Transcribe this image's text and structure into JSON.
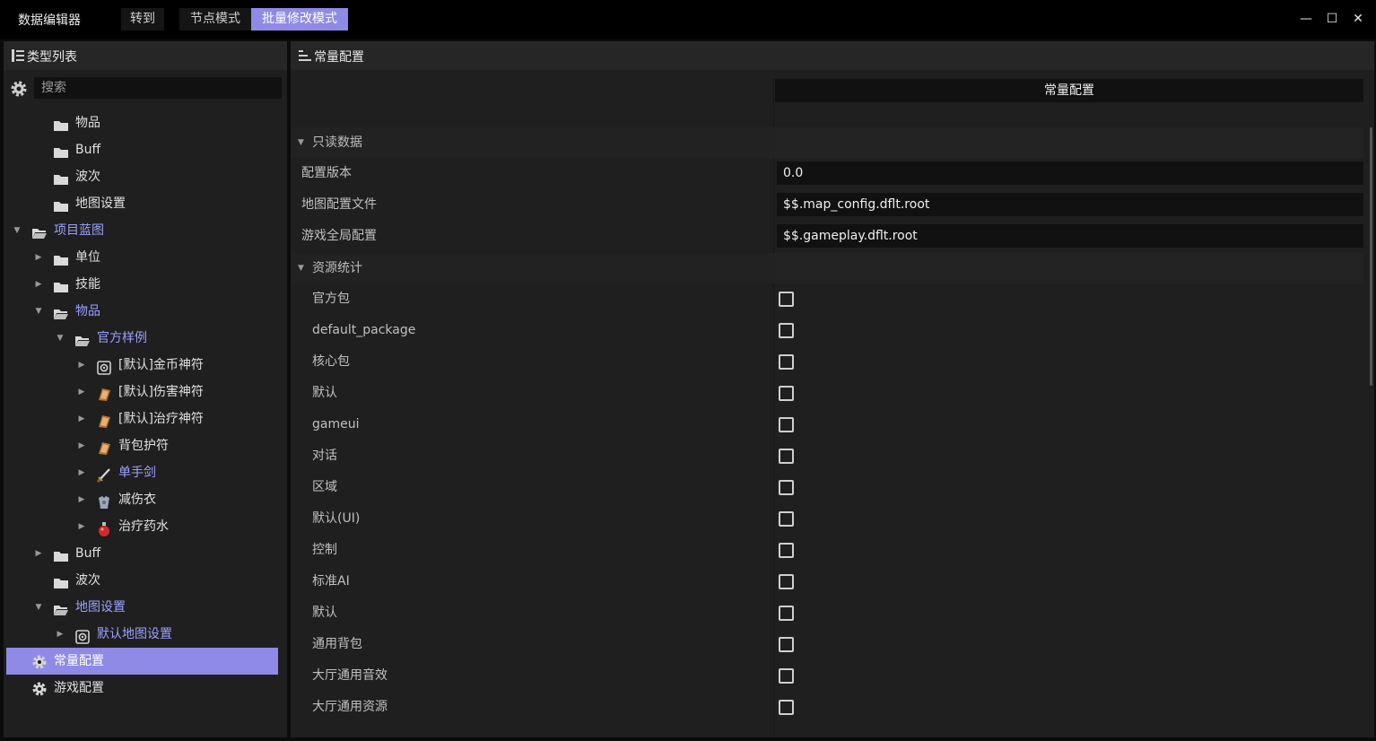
{
  "window": {
    "title": "数据编辑器",
    "menu": [
      {
        "label": "转到",
        "active": false
      },
      {
        "label": "节点模式",
        "active": false
      },
      {
        "label": "批量修改模式",
        "active": true
      }
    ],
    "controls": {
      "minimize": "—",
      "maximize": "☐",
      "close": "✕"
    }
  },
  "left": {
    "header": "类型列表",
    "search_placeholder": "搜索",
    "tree": [
      {
        "label": "物品",
        "depth": 1,
        "arrow": "",
        "icon": "folder-icon"
      },
      {
        "label": "Buff",
        "depth": 1,
        "arrow": "",
        "icon": "folder-icon"
      },
      {
        "label": "波次",
        "depth": 1,
        "arrow": "",
        "icon": "folder-icon"
      },
      {
        "label": "地图设置",
        "depth": 1,
        "arrow": "",
        "icon": "folder-icon"
      },
      {
        "label": "项目蓝图",
        "depth": 0,
        "arrow": "▼",
        "icon": "folder-open-icon",
        "highlight": true
      },
      {
        "label": "单位",
        "depth": 1,
        "arrow": "▶",
        "icon": "folder-icon"
      },
      {
        "label": "技能",
        "depth": 1,
        "arrow": "▶",
        "icon": "folder-icon"
      },
      {
        "label": "物品",
        "depth": 1,
        "arrow": "▼",
        "icon": "folder-open-icon",
        "highlight": true
      },
      {
        "label": "官方样例",
        "depth": 2,
        "arrow": "▼",
        "icon": "folder-open-icon",
        "highlight": true
      },
      {
        "label": "[默认]金币神符",
        "depth": 3,
        "arrow": "▶",
        "icon": "settings-item-icon"
      },
      {
        "label": "[默认]伤害神符",
        "depth": 3,
        "arrow": "▶",
        "icon": "scroll-icon"
      },
      {
        "label": "[默认]治疗神符",
        "depth": 3,
        "arrow": "▶",
        "icon": "scroll-icon"
      },
      {
        "label": "背包护符",
        "depth": 3,
        "arrow": "▶",
        "icon": "scroll-icon"
      },
      {
        "label": "单手剑",
        "depth": 3,
        "arrow": "▶",
        "icon": "sword-icon",
        "highlight": true
      },
      {
        "label": "减伤衣",
        "depth": 3,
        "arrow": "▶",
        "icon": "armor-icon"
      },
      {
        "label": "治疗药水",
        "depth": 3,
        "arrow": "▶",
        "icon": "potion-icon"
      },
      {
        "label": "Buff",
        "depth": 1,
        "arrow": "▶",
        "icon": "folder-icon"
      },
      {
        "label": "波次",
        "depth": 1,
        "arrow": "",
        "icon": "folder-icon"
      },
      {
        "label": "地图设置",
        "depth": 1,
        "arrow": "▼",
        "icon": "folder-open-icon",
        "highlight": true
      },
      {
        "label": "默认地图设置",
        "depth": 2,
        "arrow": "▶",
        "icon": "settings-item-icon",
        "highlight": true
      },
      {
        "label": "常量配置",
        "depth": 0,
        "arrow": "",
        "icon": "gear-icon",
        "selected": true
      },
      {
        "label": "游戏配置",
        "depth": 0,
        "arrow": "",
        "icon": "gear-icon"
      }
    ]
  },
  "right": {
    "header": "常量配置",
    "column_header": "常量配置",
    "group_readonly": "只读数据",
    "fields": [
      {
        "label": "配置版本",
        "value": "0.0"
      },
      {
        "label": "地图配置文件",
        "value": "$$.map_config.dflt.root"
      },
      {
        "label": "游戏全局配置",
        "value": "$$.gameplay.dflt.root"
      }
    ],
    "group_resources": "资源统计",
    "resources": [
      {
        "label": "官方包",
        "checked": false
      },
      {
        "label": "default_package",
        "checked": false
      },
      {
        "label": "核心包",
        "checked": false
      },
      {
        "label": "默认",
        "checked": false
      },
      {
        "label": "gameui",
        "checked": false
      },
      {
        "label": "对话",
        "checked": false
      },
      {
        "label": "区域",
        "checked": false
      },
      {
        "label": "默认(UI)",
        "checked": false
      },
      {
        "label": "控制",
        "checked": false
      },
      {
        "label": "标准AI",
        "checked": false
      },
      {
        "label": "默认",
        "checked": false
      },
      {
        "label": "通用背包",
        "checked": false
      },
      {
        "label": "大厅通用音效",
        "checked": false
      },
      {
        "label": "大厅通用资源",
        "checked": false
      }
    ]
  }
}
